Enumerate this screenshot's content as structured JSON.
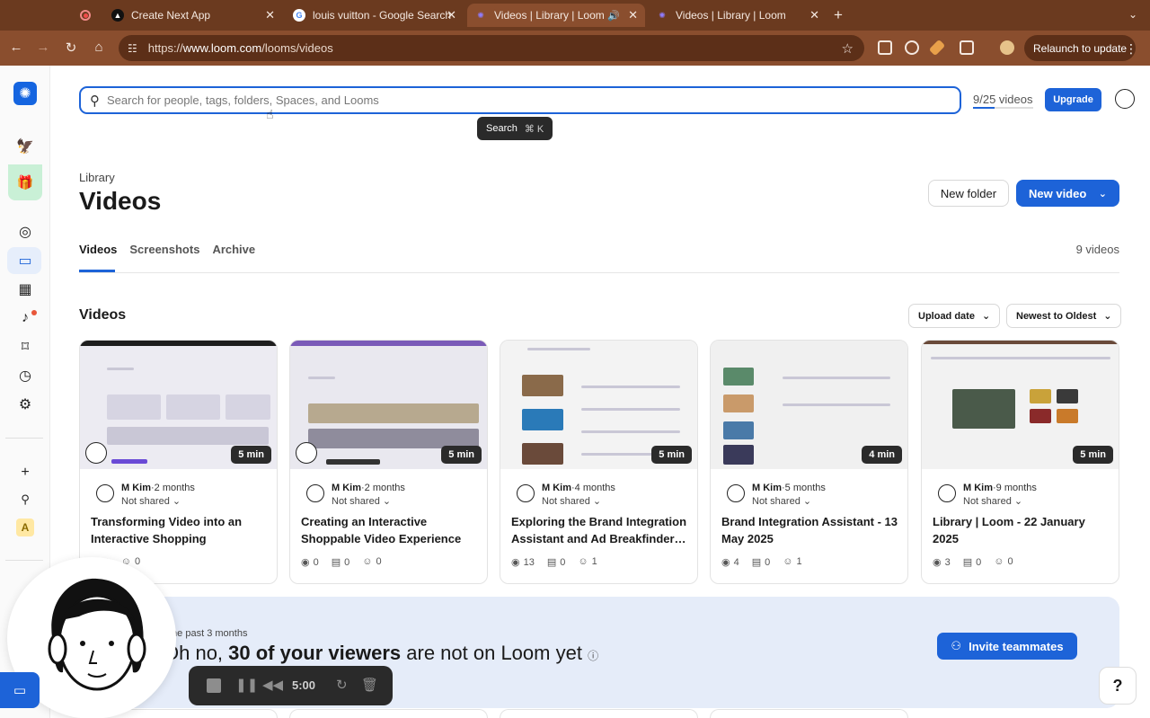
{
  "browser": {
    "tabs": [
      {
        "title": "Create Next App"
      },
      {
        "title": "louis vuitton - Google Search"
      },
      {
        "title": "Videos | Library | Loom"
      },
      {
        "title": "Videos | Library | Loom"
      }
    ],
    "url_prefix": "https://",
    "url_host": "www.loom.com",
    "url_path": "/looms/videos",
    "relaunch_label": "Relaunch to update"
  },
  "search": {
    "placeholder": "Search for people, tags, folders, Spaces, and Looms",
    "tooltip_label": "Search",
    "tooltip_keys": "⌘  K"
  },
  "usage": {
    "label": "9/25 videos",
    "fraction": 0.36
  },
  "upgrade_label": "Upgrade",
  "page": {
    "breadcrumb": "Library",
    "title": "Videos",
    "new_folder_label": "New folder",
    "new_video_label": "New video",
    "tabs": [
      "Videos",
      "Screenshots",
      "Archive"
    ],
    "video_count": "9 videos",
    "section_title": "Videos",
    "sort_field": "Upload date",
    "sort_order": "Newest to Oldest"
  },
  "cards": [
    {
      "duration": "5 min",
      "author": "M Kim",
      "age": "·2 months",
      "sharing": "Not shared",
      "title": "Transforming Video into an Interactive Shopping Experien…",
      "views": "4",
      "comments": "",
      "reactions": "0"
    },
    {
      "duration": "5 min",
      "author": "M Kim",
      "age": "·2 months",
      "sharing": "Not shared",
      "title": "Creating an Interactive Shoppable Video Experience wi…",
      "views": "0",
      "comments": "0",
      "reactions": "0"
    },
    {
      "duration": "5 min",
      "author": "M Kim",
      "age": "·4 months",
      "sharing": "Not shared",
      "title": "Exploring the Brand Integration Assistant and Ad Breakfinder…",
      "views": "13",
      "comments": "0",
      "reactions": "1"
    },
    {
      "duration": "4 min",
      "author": "M Kim",
      "age": "·5 months",
      "sharing": "Not shared",
      "title": "Brand Integration Assistant - 13 May 2025",
      "views": "4",
      "comments": "0",
      "reactions": "1"
    },
    {
      "duration": "5 min",
      "author": "M Kim",
      "age": "·9 months",
      "sharing": "Not shared",
      "title": "Library | Loom - 22 January 2025",
      "views": "3",
      "comments": "0",
      "reactions": "0"
    }
  ],
  "banner": {
    "sub": "the past 3 months",
    "head_prefix": "Oh no, ",
    "head_bold": "30 of your viewers",
    "head_suffix": " are not on Loom yet",
    "invite_label": "Invite teammates"
  },
  "recorder": {
    "time": "5:00"
  },
  "help_label": "?",
  "colors": {
    "accent": "#1d63d8",
    "browser_frame": "#6b3a1f",
    "banner_bg": "#e5ecf9"
  }
}
